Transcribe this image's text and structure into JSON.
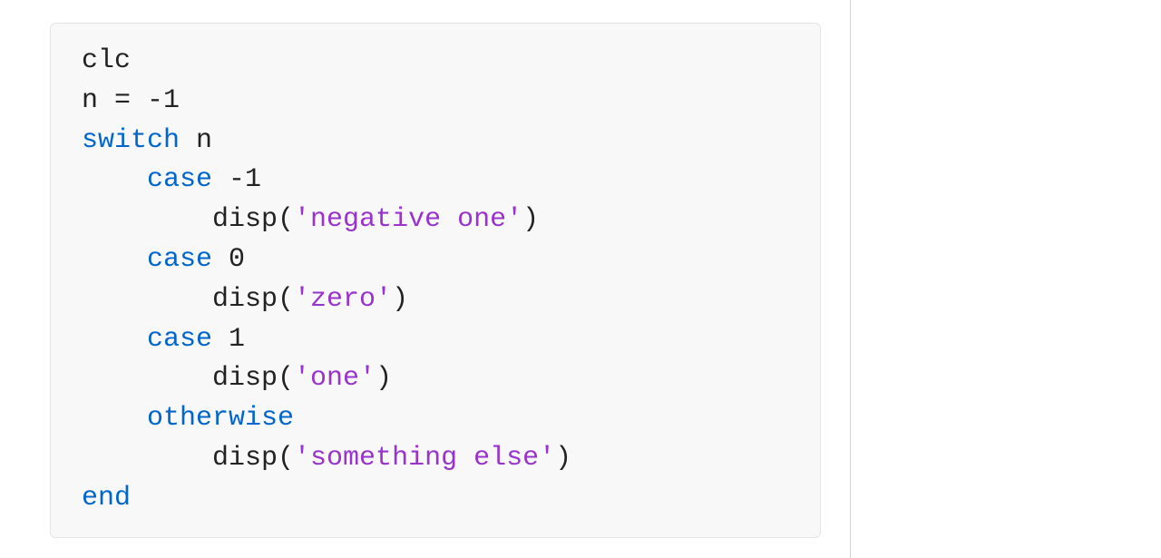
{
  "code": {
    "line1": "clc",
    "line2_a": "n = ",
    "line2_b": "-1",
    "line3_kw": "switch",
    "line3_var": " n",
    "line4_kw": "    case",
    "line4_val": " -1",
    "line5_a": "        disp(",
    "line5_str": "'negative one'",
    "line5_b": ")",
    "line6_kw": "    case",
    "line6_val": " 0",
    "line7_a": "        disp(",
    "line7_str": "'zero'",
    "line7_b": ")",
    "line8_kw": "    case",
    "line8_val": " 1",
    "line9_a": "        disp(",
    "line9_str": "'one'",
    "line9_b": ")",
    "line10_kw": "    otherwise",
    "line11_a": "        disp(",
    "line11_str": "'something else'",
    "line11_b": ")",
    "line12_kw": "end"
  }
}
